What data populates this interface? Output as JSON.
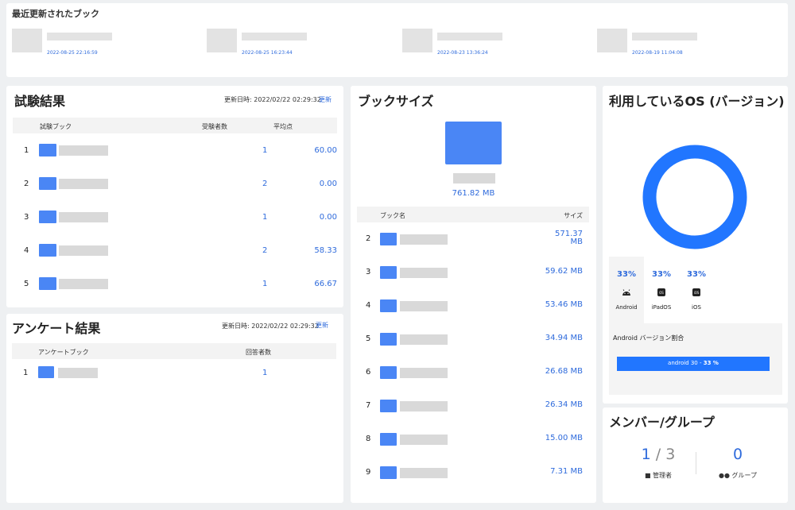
{
  "recent": {
    "title": "最近更新されたブック",
    "items": [
      {
        "date": "2022-08-25 22:16:59"
      },
      {
        "date": "2022-08-25 16:23:44"
      },
      {
        "date": "2022-08-23 13:36:24"
      },
      {
        "date": "2022-08-19 11:04:08"
      }
    ]
  },
  "exam": {
    "title": "試験結果",
    "updated_label": "更新日時: 2022/02/22 02:29:32",
    "update_link": "更新",
    "headers": {
      "book": "試験ブック",
      "examinees": "受験者数",
      "avg": "平均点"
    },
    "rows": [
      {
        "rank": "1",
        "examinees": "1",
        "avg": "60.00"
      },
      {
        "rank": "2",
        "examinees": "2",
        "avg": "0.00"
      },
      {
        "rank": "3",
        "examinees": "1",
        "avg": "0.00"
      },
      {
        "rank": "4",
        "examinees": "2",
        "avg": "58.33"
      },
      {
        "rank": "5",
        "examinees": "1",
        "avg": "66.67"
      }
    ]
  },
  "survey": {
    "title": "アンケート結果",
    "updated_label": "更新日時: 2022/02/22 02:29:32",
    "update_link": "更新",
    "headers": {
      "book": "アンケートブック",
      "respondents": "回答者数"
    },
    "rows": [
      {
        "rank": "1",
        "respondents": "1"
      }
    ]
  },
  "booksize": {
    "title": "ブックサイズ",
    "total": "761.82 MB",
    "headers": {
      "name": "ブック名",
      "size": "サイズ"
    },
    "rows": [
      {
        "rank": "2",
        "size": "571.37 MB"
      },
      {
        "rank": "3",
        "size": "59.62 MB"
      },
      {
        "rank": "4",
        "size": "53.46 MB"
      },
      {
        "rank": "5",
        "size": "34.94 MB"
      },
      {
        "rank": "6",
        "size": "26.68 MB"
      },
      {
        "rank": "7",
        "size": "26.34 MB"
      },
      {
        "rank": "8",
        "size": "15.00 MB"
      },
      {
        "rank": "9",
        "size": "7.31 MB"
      }
    ]
  },
  "os": {
    "title": "利用しているOS (バージョン)",
    "donut_color": "#2176ff",
    "platforms": [
      {
        "name": "Android",
        "percent": "33%",
        "icon": "android-icon"
      },
      {
        "name": "iPadOS",
        "percent": "33%",
        "icon": "ipados-icon"
      },
      {
        "name": "iOS",
        "percent": "33%",
        "icon": "ios-icon"
      }
    ],
    "selected": "Android",
    "version_title": "Android バージョン割合",
    "version_bar": {
      "label": "android 30",
      "percent": "33 %",
      "fill": 1.0
    }
  },
  "members": {
    "title": "メンバー/グループ",
    "admins": "1",
    "separator": "/",
    "total": "3",
    "admin_label": "管理者",
    "groups": "0",
    "group_label": "グループ"
  }
}
